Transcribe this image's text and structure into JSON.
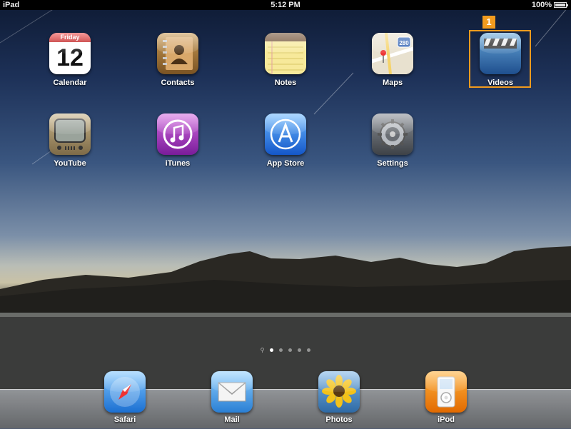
{
  "status_bar": {
    "device": "iPad",
    "time": "5:12 PM",
    "battery_text": "100%",
    "battery_level": 1.0
  },
  "home_screen": {
    "apps": [
      {
        "id": "calendar",
        "label": "Calendar",
        "day_name": "Friday",
        "day_number": "12"
      },
      {
        "id": "contacts",
        "label": "Contacts"
      },
      {
        "id": "notes",
        "label": "Notes"
      },
      {
        "id": "maps",
        "label": "Maps",
        "road_sign": "280"
      },
      {
        "id": "videos",
        "label": "Videos"
      },
      {
        "id": "youtube",
        "label": "YouTube"
      },
      {
        "id": "itunes",
        "label": "iTunes"
      },
      {
        "id": "appstore",
        "label": "App Store"
      },
      {
        "id": "settings",
        "label": "Settings"
      }
    ]
  },
  "highlight_marker": {
    "number": "1",
    "color": "#f29b1e"
  },
  "page_indicator": {
    "pages": 5,
    "current": 1
  },
  "dock": {
    "apps": [
      {
        "id": "safari",
        "label": "Safari"
      },
      {
        "id": "mail",
        "label": "Mail"
      },
      {
        "id": "photos",
        "label": "Photos"
      },
      {
        "id": "ipod",
        "label": "iPod"
      }
    ]
  }
}
